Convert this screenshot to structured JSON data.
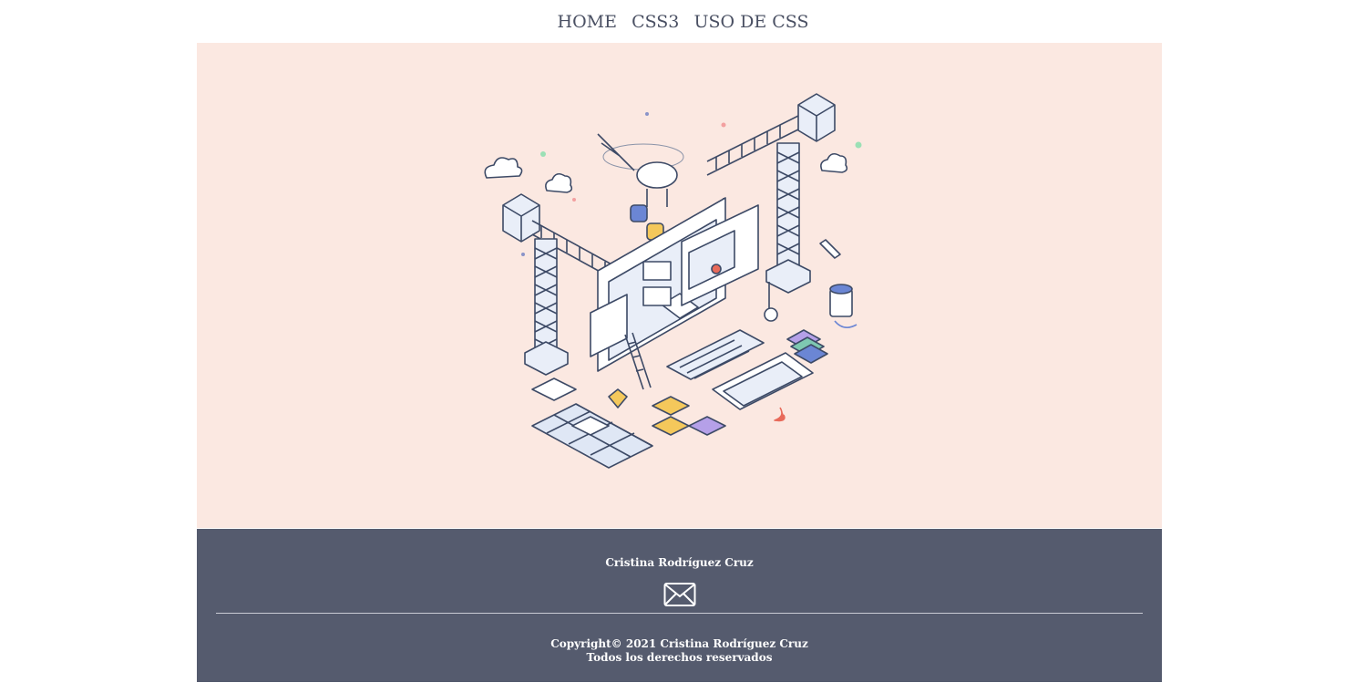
{
  "nav": {
    "items": [
      {
        "label": "HOME"
      },
      {
        "label": "CSS3"
      },
      {
        "label": "USO DE CSS"
      }
    ]
  },
  "hero": {
    "illustration_icon": "web-construction-illustration",
    "background_color": "#fbe8e1"
  },
  "footer": {
    "author": "Cristina Rodríguez Cruz",
    "mail_icon": "envelope-icon",
    "copyright": "Copyright© 2021 Cristina Rodríguez Cruz",
    "rights": "Todos los derechos reservados",
    "background_color": "#555b6e"
  }
}
